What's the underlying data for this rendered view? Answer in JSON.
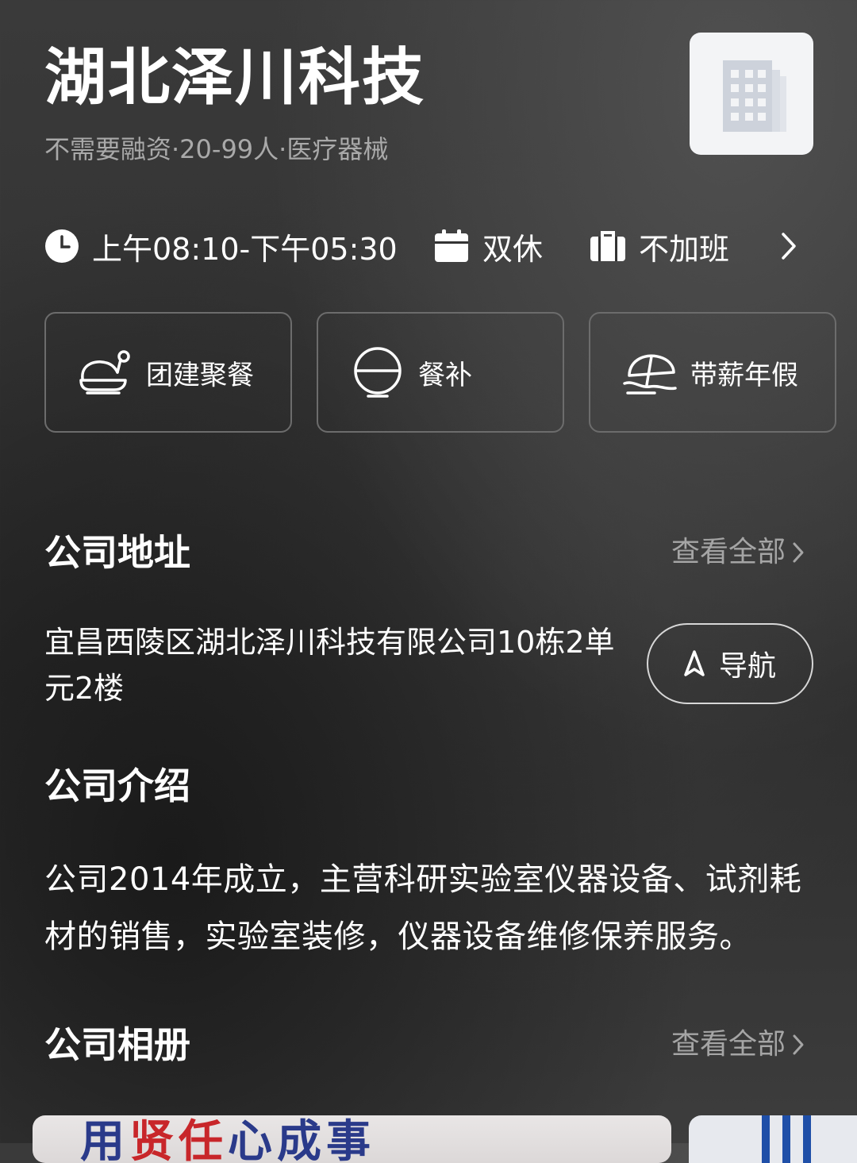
{
  "company": {
    "name": "湖北泽川科技",
    "subtitle": "不需要融资·20-99人·医疗器械",
    "logo_icon": "building-icon"
  },
  "work_info": {
    "hours": "上午08:10-下午05:30",
    "rest": "双休",
    "overtime": "不加班"
  },
  "benefits": [
    {
      "label": "团建聚餐",
      "icon": "roast-chicken-icon"
    },
    {
      "label": "餐补",
      "icon": "rice-bowl-icon"
    },
    {
      "label": "带薪年假",
      "icon": "beach-umbrella-icon"
    }
  ],
  "address_section": {
    "title": "公司地址",
    "see_all": "查看全部",
    "address": "宜昌西陵区湖北泽川科技有限公司10栋2单元2楼",
    "nav_label": "导航"
  },
  "intro_section": {
    "title": "公司介绍",
    "text": "公司2014年成立，主营科研实验室仪器设备、试剂耗材的销售，实验室装修，仪器设备维修保养服务。"
  },
  "album_section": {
    "title": "公司相册",
    "see_all": "查看全部",
    "photo1_text_a": "用",
    "photo1_text_b": "贤",
    "photo1_text_c": "任",
    "photo1_text_d": "心",
    "photo1_text_e": "成",
    "photo1_text_f": "事"
  },
  "colors": {
    "background": "#333333",
    "secondary_text": "#a9a9a9",
    "card_border": "#6c6c6c"
  }
}
